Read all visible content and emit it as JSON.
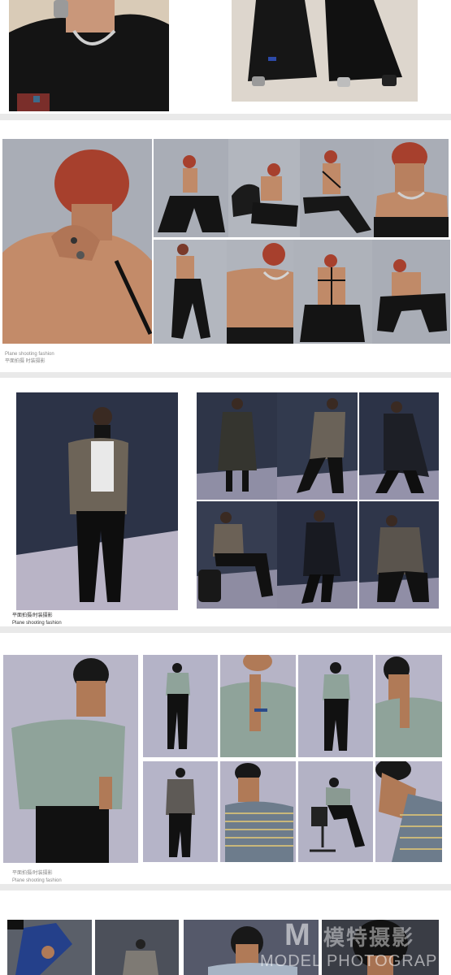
{
  "sections": [
    {
      "id": "s1",
      "caption_en": "",
      "caption_cn": ""
    },
    {
      "id": "s2",
      "caption_en": "Plane shooting fashion",
      "caption_cn": "平面拍摄 时装摄影"
    },
    {
      "id": "s3",
      "caption_cn": "平面拍摄/时装摄影",
      "caption_en": "Plane shooting fashion"
    },
    {
      "id": "s4",
      "caption_cn": "平面拍摄/时装摄影",
      "caption_en": "Plane shooting fashion"
    },
    {
      "id": "s5",
      "caption_en": "",
      "caption_cn": ""
    }
  ],
  "watermark": {
    "logo_letter": "M",
    "cn_text": "模特摄影",
    "en_text": "MODEL PHOTOGRAPHY"
  },
  "colors": {
    "page_bg": "#e9e9e9",
    "card_bg": "#ffffff",
    "studio_grey": "#a9adb6",
    "studio_navy": "#2c3347",
    "studio_lavender": "#b8b6c8",
    "hair_red": "#a7402d",
    "skin": "#c08a68",
    "shirt_sage": "#8fa39a"
  }
}
